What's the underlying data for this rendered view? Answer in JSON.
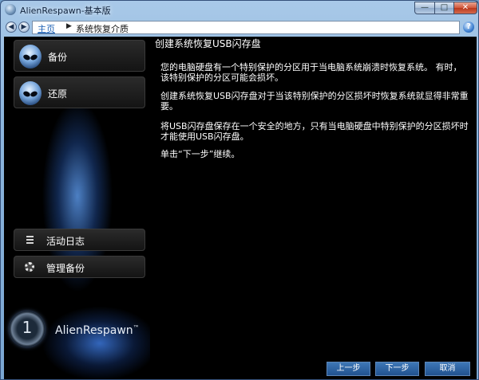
{
  "window": {
    "title": "AlienRespawn-基本版",
    "minimize": "—",
    "maximize": "□",
    "close": "✕"
  },
  "nav": {
    "back": "◀",
    "forward": "▶",
    "home": "主页",
    "separator": "▶",
    "crumb": "系统恢复介质",
    "help": "?"
  },
  "sidebar": {
    "items": [
      {
        "label": "备份"
      },
      {
        "label": "还原"
      },
      {
        "label": "活动日志"
      },
      {
        "label": "管理备份"
      }
    ],
    "logo": {
      "digit": "1",
      "name": "AlienRespawn",
      "tm": "™"
    }
  },
  "main": {
    "title": "创建系统恢复USB闪存盘",
    "paragraphs": [
      "您的电脑硬盘有一个特别保护的分区用于当电脑系统崩溃时恢复系统。 有时，该特别保护的分区可能会损坏。",
      "创建系统恢复USB闪存盘对于当该特别保护的分区损坏时恢复系统就显得非常重要。",
      "将USB闪存盘保存在一个安全的地方，只有当电脑硬盘中特别保护的分区损坏时才能使用USB闪存盘。",
      "单击“下一步”继续。"
    ]
  },
  "buttons": {
    "prev": "上一步",
    "next": "下一步",
    "cancel": "取消"
  }
}
